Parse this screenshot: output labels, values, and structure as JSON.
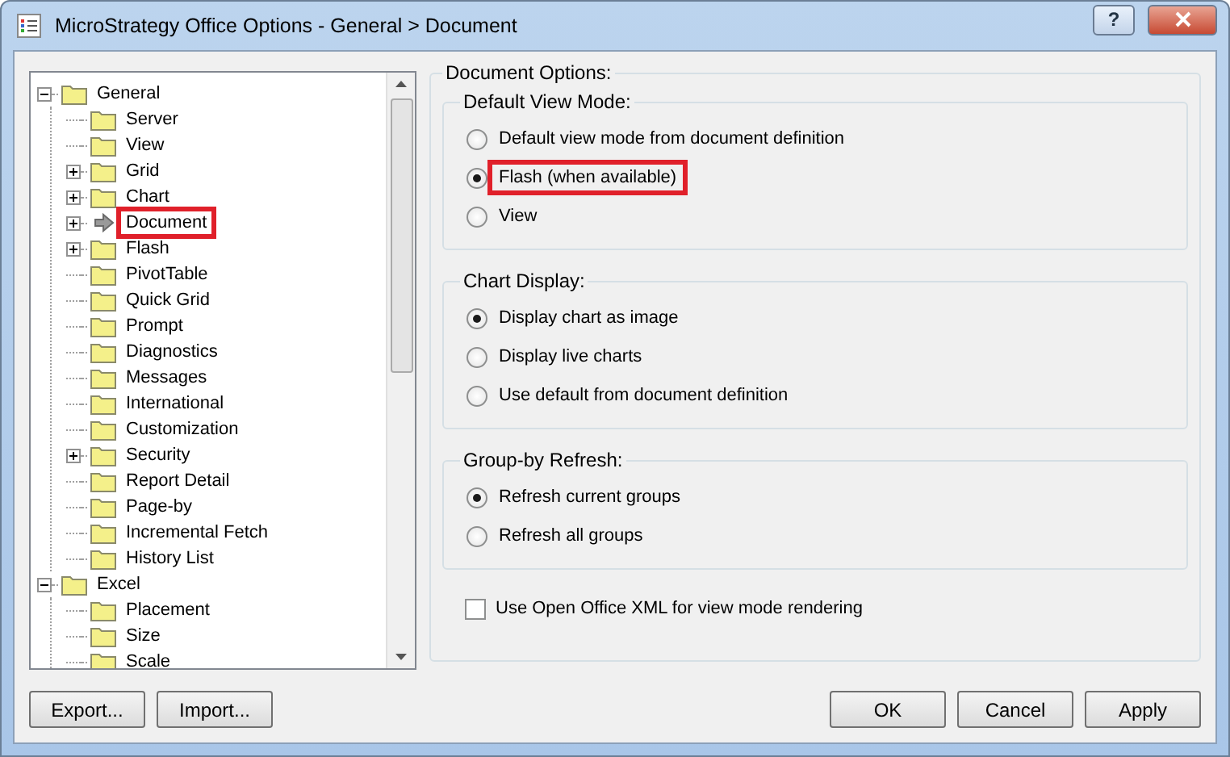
{
  "window": {
    "title": "MicroStrategy Office Options - General > Document",
    "help_button": "?"
  },
  "tree": [
    {
      "label": "General",
      "kind": "folder",
      "expanded": true,
      "highlighted": false,
      "children": [
        {
          "label": "Server",
          "kind": "folder",
          "highlighted": false
        },
        {
          "label": "View",
          "kind": "folder",
          "highlighted": false
        },
        {
          "label": "Grid",
          "kind": "folder",
          "expanded": false,
          "highlighted": false
        },
        {
          "label": "Chart",
          "kind": "folder",
          "expanded": false,
          "highlighted": false
        },
        {
          "label": "Document",
          "kind": "current",
          "expanded": false,
          "highlighted": true
        },
        {
          "label": "Flash",
          "kind": "folder",
          "expanded": false,
          "highlighted": false
        },
        {
          "label": "PivotTable",
          "kind": "folder",
          "highlighted": false
        },
        {
          "label": "Quick Grid",
          "kind": "folder",
          "highlighted": false
        },
        {
          "label": "Prompt",
          "kind": "folder",
          "highlighted": false
        },
        {
          "label": "Diagnostics",
          "kind": "folder",
          "highlighted": false
        },
        {
          "label": "Messages",
          "kind": "folder",
          "highlighted": false
        },
        {
          "label": "International",
          "kind": "folder",
          "highlighted": false
        },
        {
          "label": "Customization",
          "kind": "folder",
          "highlighted": false
        },
        {
          "label": "Security",
          "kind": "folder",
          "expanded": false,
          "highlighted": false
        },
        {
          "label": "Report Detail",
          "kind": "folder",
          "highlighted": false
        },
        {
          "label": "Page-by",
          "kind": "folder",
          "highlighted": false
        },
        {
          "label": "Incremental Fetch",
          "kind": "folder",
          "highlighted": false
        },
        {
          "label": "History List",
          "kind": "folder",
          "highlighted": false
        }
      ]
    },
    {
      "label": "Excel",
      "kind": "folder",
      "expanded": true,
      "highlighted": false,
      "children": [
        {
          "label": "Placement",
          "kind": "folder",
          "highlighted": false
        },
        {
          "label": "Size",
          "kind": "folder",
          "highlighted": false
        },
        {
          "label": "Scale",
          "kind": "folder",
          "highlighted": false
        }
      ]
    }
  ],
  "options": {
    "title": "Document Options:",
    "groups": [
      {
        "title": "Default View Mode:",
        "items": [
          {
            "label": "Default view mode from document definition",
            "selected": false,
            "highlighted": false
          },
          {
            "label": "Flash (when available)",
            "selected": true,
            "highlighted": true
          },
          {
            "label": "View",
            "selected": false,
            "highlighted": false
          }
        ]
      },
      {
        "title": "Chart Display:",
        "items": [
          {
            "label": "Display chart as image",
            "selected": true,
            "highlighted": false
          },
          {
            "label": "Display live charts",
            "selected": false,
            "highlighted": false
          },
          {
            "label": "Use default from document definition",
            "selected": false,
            "highlighted": false
          }
        ]
      },
      {
        "title": "Group-by Refresh:",
        "items": [
          {
            "label": "Refresh current groups",
            "selected": true,
            "highlighted": false
          },
          {
            "label": "Refresh all groups",
            "selected": false,
            "highlighted": false
          }
        ]
      }
    ],
    "checkbox": {
      "label": "Use Open Office XML for view mode rendering",
      "checked": false
    }
  },
  "left_buttons": [
    "Export...",
    "Import..."
  ],
  "right_buttons": [
    "OK",
    "Cancel",
    "Apply"
  ]
}
